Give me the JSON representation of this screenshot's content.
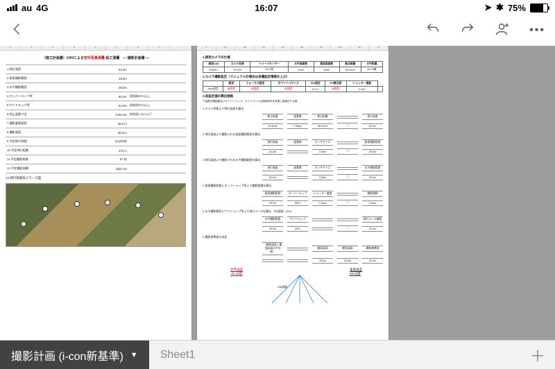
{
  "status": {
    "carrier": "au",
    "net": "4G",
    "time": "16:07",
    "battery": "75%"
  },
  "tabs": {
    "active": "撮影計画 (i-con新基準)",
    "second": "Sheet1"
  },
  "page1": {
    "title_pre": "（施工計画書）UAVによる",
    "title_red": "空中写真測量",
    "title_post": " 起工測量　― 撮影計画書 ―",
    "rows": [
      {
        "n": "1.飛行高度",
        "v": "52.0m",
        "note": ""
      },
      {
        "n": "2.垂直撮影範囲",
        "v": "29.0m",
        "note": ""
      },
      {
        "n": "3.水平撮影範囲",
        "v": "39.0m",
        "note": ""
      },
      {
        "n": "4.オーバーラップ率",
        "v": "80.0%",
        "note": "規格値80%以上"
      },
      {
        "n": "5.サイドラップ率",
        "v": "61.5%",
        "note": "規格値60%以上"
      },
      {
        "n": "6.地上画素寸法",
        "v": "0.88 c/m",
        "note": "規格値1.0cm以下"
      },
      {
        "n": "7.撮影基準面高",
        "v": "38.6 m",
        "note": ""
      },
      {
        "n": "8.撮影高度",
        "v": "66.8 m",
        "note": ""
      },
      {
        "n": "9.予定飛行時間",
        "v": "11分54秒",
        "note": ""
      },
      {
        "n": "10.予定飛行距離",
        "v": "272 m",
        "note": ""
      },
      {
        "n": "11.予定撮影枚数",
        "v": "67 枚",
        "note": ""
      },
      {
        "n": "12.予定撮影面積",
        "v": "4332 m2",
        "note": ""
      }
    ],
    "sec13": "13.飛行経路及びコース図"
  },
  "page2": {
    "sec1": "1.使用カメラの仕様",
    "cam": {
      "hdr": [
        "使用UAV",
        "カメラ名称",
        "イメージセンサー",
        "水平画素数",
        "垂直画素数",
        "焦点距離",
        "水平距離"
      ],
      "row": [
        "MAVIC",
        "FC220",
        "1/2.3型",
        "4000",
        "3000",
        "35.0mm",
        "44.23度"
      ]
    },
    "sec2": "2.カメラ撮影設定（マニュアルの場合は各種設定情報を入力）",
    "set": {
      "hdr": [
        "",
        "設定",
        "フォーカス設定",
        "ホワイトバランス",
        "ISO設定",
        "EV補正値",
        "シャッター速度"
      ],
      "row": [
        "Auto設定",
        "未設定",
        "未設定",
        "未設定",
        "AUTO",
        "未設定",
        "2,000",
        ""
      ]
    },
    "sec3": "3.各設定値の算出根拠",
    "note3": "※各標点間距離及びオーバーラップ・サイドラップは現地条件を考慮し再検討する事",
    "calcs": [
      {
        "t": "1.カメラ性能より飛行高度を算出",
        "c": [
          "焦点距離",
          "画素数",
          "焦点距離",
          "",
          "飛行高度"
        ],
        "v": [
          "10.9mm",
          "1.50μm",
          "35.0mm",
          "＝",
          "52.0m"
        ]
      },
      {
        "t": "2.飛行高度より撮影される垂直撮影範囲を算出",
        "c": [
          "飛行高度",
          "画素数",
          "センササイズ",
          "",
          "垂直撮影範囲"
        ],
        "v": [
          "52.0m",
          "",
          "0.50m",
          "＝",
          "29.0m"
        ]
      },
      {
        "t": "3.飛行高度より撮影される水平撮影範囲を算出",
        "c": [
          "飛行高度",
          "画素数",
          "センササイズ",
          "",
          "水平撮影範囲"
        ],
        "v": [
          "52.0m",
          "",
          "0.50m",
          "＝",
          "39.0m"
        ]
      },
      {
        "t": "4.垂直撮影距離とオーバーラップ率より撮影間隔を算出",
        "c": [
          "垂直撮影範囲",
          "オーバーラップ",
          "シャッター速度",
          "",
          "撮影間隔"
        ],
        "v": [
          "29.0m",
          "80%",
          "2.0sec",
          "＝",
          "2.9sec"
        ]
      },
      {
        "t": "5.水平撮影範囲とサイドラップ率より飛行コースを算出 （計画値）60%",
        "c": [
          "水平撮影範囲",
          "サイドラップ",
          "",
          "",
          "飛行コース間隔"
        ],
        "v": [
          "39.0m",
          "60%",
          "",
          "＝",
          "15.0m"
        ]
      },
      {
        "t": "6.撮影基準面の決定",
        "c": [
          "（基準面高＋最低面高の平均値）",
          "",
          "最高面高",
          "最低面高",
          "撮影基準面"
        ],
        "v": [
          "",
          "",
          "38.6m",
          "30.6m",
          "49.3m"
        ]
      }
    ],
    "diag": {
      "left_lbl": "水平誤差",
      "left_v": "-63.30度",
      "right_lbl": "垂直誤差",
      "right_v": "49.23度",
      "center": "336度幅"
    }
  }
}
